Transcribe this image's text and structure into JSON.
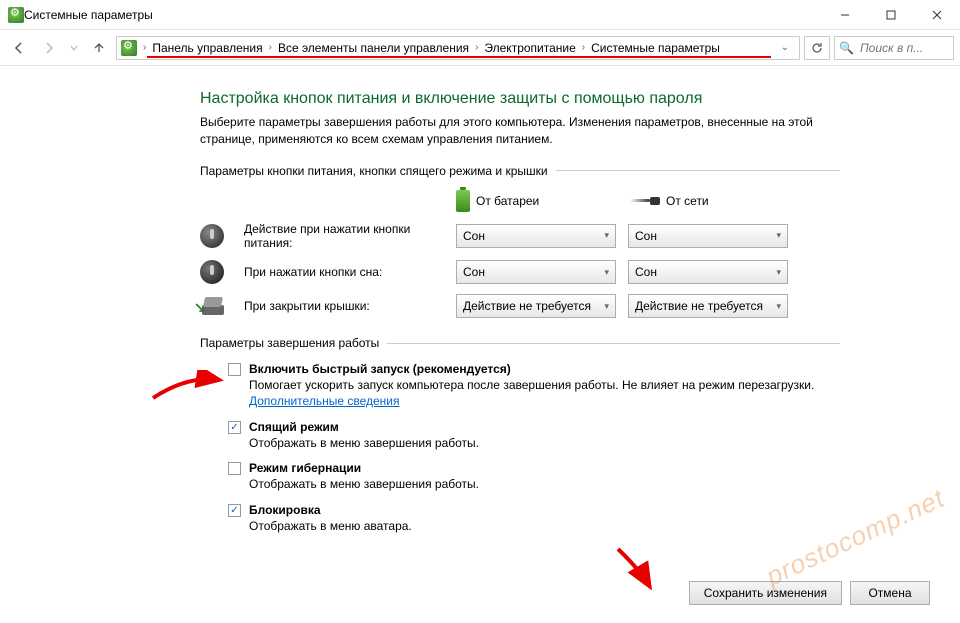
{
  "window": {
    "title": "Системные параметры"
  },
  "breadcrumb": {
    "items": [
      "Панель управления",
      "Все элементы панели управления",
      "Электропитание",
      "Системные параметры"
    ]
  },
  "search": {
    "placeholder": "Поиск в п..."
  },
  "heading": "Настройка кнопок питания и включение защиты с помощью пароля",
  "description": "Выберите параметры завершения работы для этого компьютера. Изменения параметров, внесенные на этой странице, применяются ко всем схемам управления питанием.",
  "section1": {
    "title": "Параметры кнопки питания, кнопки спящего режима и крышки",
    "col_battery": "От батареи",
    "col_ac": "От сети",
    "rows": [
      {
        "label": "Действие при нажатии кнопки питания:",
        "battery": "Сон",
        "ac": "Сон"
      },
      {
        "label": "При нажатии кнопки сна:",
        "battery": "Сон",
        "ac": "Сон"
      },
      {
        "label": "При закрытии крышки:",
        "battery": "Действие не требуется",
        "ac": "Действие не требуется"
      }
    ]
  },
  "section2": {
    "title": "Параметры завершения работы",
    "items": [
      {
        "checked": false,
        "label": "Включить быстрый запуск (рекомендуется)",
        "sub": "Помогает ускорить запуск компьютера после завершения работы. Не влияет на режим перезагрузки.",
        "link": "Дополнительные сведения"
      },
      {
        "checked": true,
        "label": "Спящий режим",
        "sub": "Отображать в меню завершения работы."
      },
      {
        "checked": false,
        "label": "Режим гибернации",
        "sub": "Отображать в меню завершения работы."
      },
      {
        "checked": true,
        "label": "Блокировка",
        "sub": "Отображать в меню аватара."
      }
    ]
  },
  "footer": {
    "save": "Сохранить изменения",
    "cancel": "Отмена"
  },
  "watermark": "prostocomp.net"
}
